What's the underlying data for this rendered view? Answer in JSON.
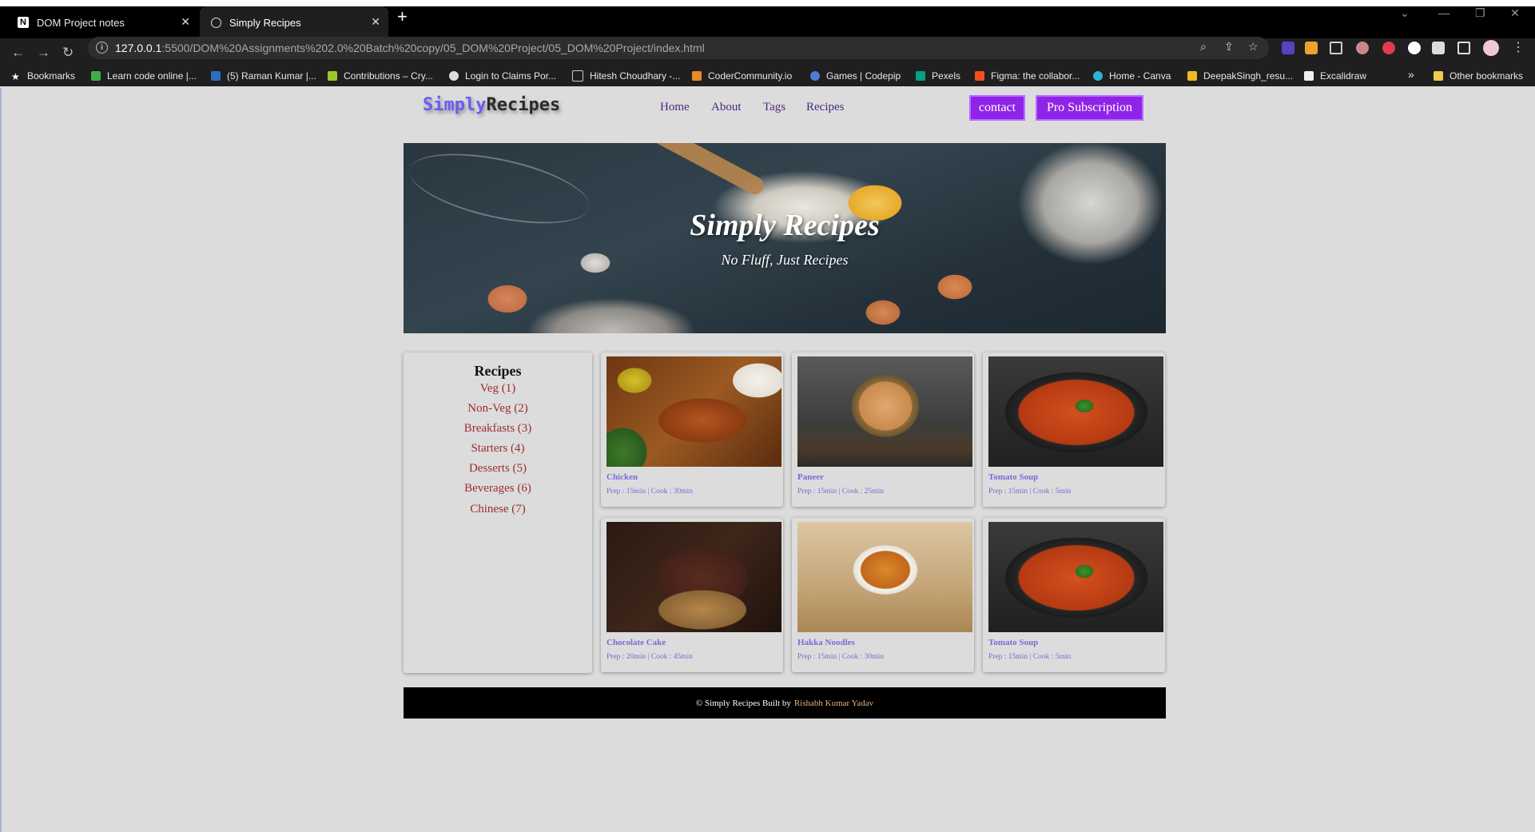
{
  "browser": {
    "tabs": [
      {
        "title": "DOM Project notes",
        "icon": "notion-icon"
      },
      {
        "title": "Simply Recipes",
        "icon": "globe-icon"
      }
    ],
    "url_host": "127.0.0.1",
    "url_rest": ":5500/DOM%20Assignments%202.0%20Batch%20copy/05_DOM%20Project/05_DOM%20Project/index.html",
    "bookmarks": [
      "Bookmarks",
      "Learn code online |...",
      "(5) Raman Kumar |...",
      "Contributions – Cry...",
      "Login to Claims Por...",
      "Hitesh Choudhary -...",
      "CoderCommunity.io",
      "Games | Codepip",
      "Pexels",
      "Figma: the collabor...",
      "Home - Canva",
      "DeepakSingh_resu...",
      "Excalidraw"
    ],
    "overflow": "»",
    "other_bookmarks": "Other bookmarks"
  },
  "site": {
    "logo_a": "Simply",
    "logo_b": "Recipes",
    "nav": [
      "Home",
      "About",
      "Tags",
      "Recipes"
    ],
    "contact_label": "contact",
    "pro_label": "Pro Subscription",
    "hero_title": "Simply Recipes",
    "hero_subtitle": "No Fluff, Just Recipes",
    "sidebar_heading": "Recipes",
    "categories": [
      "Veg (1)",
      "Non-Veg (2)",
      "Breakfasts (3)",
      "Starters (4)",
      "Desserts (5)",
      "Beverages (6)",
      "Chinese (7)"
    ],
    "cards": [
      {
        "name": "Chicken",
        "meta": "Prep : 15min | Cook : 30min"
      },
      {
        "name": "Paneer",
        "meta": "Prep : 15min | Cook : 25min"
      },
      {
        "name": "Tomato Soup",
        "meta": "Prep : 15min | Cook : 5min"
      },
      {
        "name": "Chocolate Cake",
        "meta": "Prep : 20min | Cook : 45min"
      },
      {
        "name": "Hakka Noodles",
        "meta": "Prep : 15min | Cook : 30min"
      },
      {
        "name": "Tomato Soup",
        "meta": "Prep : 15min | Cook : 5min"
      }
    ],
    "footer_text": "© Simply Recipes Built by",
    "footer_author": "Rishabh Kumar Yadav",
    "colors": {
      "accent": "#8f24e8",
      "logo": "#6b5cf5",
      "category": "#9b2d2d",
      "card_text": "#7a6ad6"
    }
  }
}
